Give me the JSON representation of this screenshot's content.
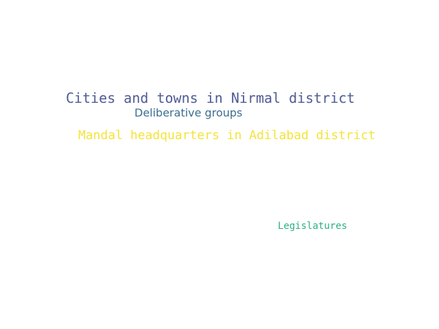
{
  "words": [
    {
      "text": "Cities and towns in Nirmal district",
      "color": "#4f5b93"
    },
    {
      "text": "Deliberative groups",
      "color": "#3b6e8f"
    },
    {
      "text": "Mandal headquarters in Adilabad district",
      "color": "#f5e33a"
    },
    {
      "text": "Legislatures",
      "color": "#2bb07f"
    }
  ]
}
